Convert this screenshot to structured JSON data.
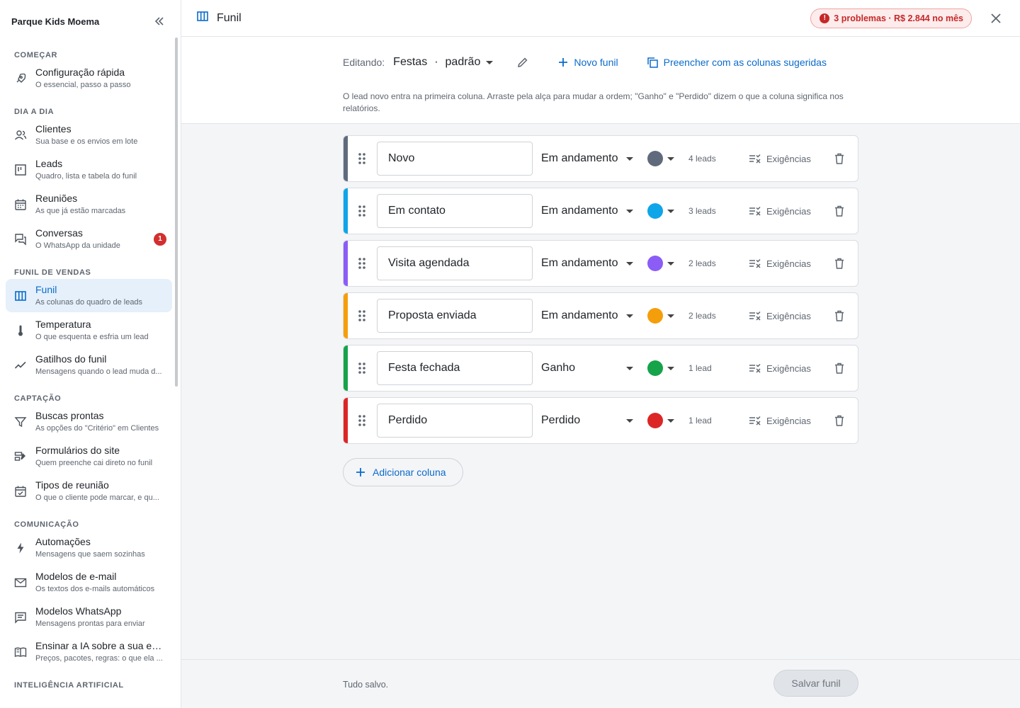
{
  "sidebar": {
    "title": "Parque Kids Moema",
    "sections": [
      {
        "title": "COMEÇAR",
        "items": [
          {
            "name": "configuracao-rapida",
            "icon": "rocket-icon",
            "label": "Configuração rápida",
            "sub": "O essencial, passo a passo"
          }
        ]
      },
      {
        "title": "DIA A DIA",
        "items": [
          {
            "name": "clientes",
            "icon": "people-icon",
            "label": "Clientes",
            "sub": "Sua base e os envios em lote"
          },
          {
            "name": "leads",
            "icon": "board-icon",
            "label": "Leads",
            "sub": "Quadro, lista e tabela do funil"
          },
          {
            "name": "reunioes",
            "icon": "calendar-icon",
            "label": "Reuniões",
            "sub": "As que já estão marcadas"
          },
          {
            "name": "conversas",
            "icon": "chat-icon",
            "label": "Conversas",
            "sub": "O WhatsApp da unidade",
            "badge": "1"
          }
        ]
      },
      {
        "title": "FUNIL DE VENDAS",
        "items": [
          {
            "name": "funil",
            "icon": "columns-icon",
            "label": "Funil",
            "sub": "As colunas do quadro de leads",
            "active": true
          },
          {
            "name": "temperatura",
            "icon": "thermometer-icon",
            "label": "Temperatura",
            "sub": "O que esquenta e esfria um lead"
          },
          {
            "name": "gatilhos",
            "icon": "trend-icon",
            "label": "Gatilhos do funil",
            "sub": "Mensagens quando o lead muda d..."
          }
        ]
      },
      {
        "title": "CAPTAÇÃO",
        "items": [
          {
            "name": "buscas",
            "icon": "filter-icon",
            "label": "Buscas prontas",
            "sub": "As opções do \"Critério\" em Clientes"
          },
          {
            "name": "formularios",
            "icon": "form-icon",
            "label": "Formulários do site",
            "sub": "Quem preenche cai direto no funil"
          },
          {
            "name": "tipos-reuniao",
            "icon": "calendar-check-icon",
            "label": "Tipos de reunião",
            "sub": "O que o cliente pode marcar, e qu..."
          }
        ]
      },
      {
        "title": "COMUNICAÇÃO",
        "items": [
          {
            "name": "automacoes",
            "icon": "bolt-icon",
            "label": "Automações",
            "sub": "Mensagens que saem sozinhas"
          },
          {
            "name": "modelos-email",
            "icon": "mail-icon",
            "label": "Modelos de e-mail",
            "sub": "Os textos dos e-mails automáticos"
          },
          {
            "name": "modelos-whatsapp",
            "icon": "message-icon",
            "label": "Modelos WhatsApp",
            "sub": "Mensagens prontas para enviar"
          },
          {
            "name": "ensinar-ia",
            "icon": "book-icon",
            "label": "Ensinar a IA sobre a sua em...",
            "sub": "Preços, pacotes, regras: o que ela ..."
          }
        ]
      },
      {
        "title": "INTELIGÊNCIA ARTIFICIAL",
        "items": []
      }
    ]
  },
  "topbar": {
    "title": "Funil",
    "problems": "3 problemas · R$ 2.844 no mês"
  },
  "editor": {
    "label": "Editando:",
    "funnel_name": "Festas",
    "funnel_tag": "padrão",
    "new_funnel": "Novo funil",
    "fill_suggested": "Preencher com as colunas sugeridas",
    "hint": "O lead novo entra na primeira coluna. Arraste pela alça para mudar a ordem; \"Ganho\" e \"Perdido\" dizem o que a coluna significa nos relatórios."
  },
  "columns": [
    {
      "name": "Novo",
      "status": "Em andamento",
      "color": "#5f6b7d",
      "count": "4 leads",
      "req": "Exigências"
    },
    {
      "name": "Em contato",
      "status": "Em andamento",
      "color": "#0ea5e9",
      "count": "3 leads",
      "req": "Exigências"
    },
    {
      "name": "Visita agendada",
      "status": "Em andamento",
      "color": "#8b5cf6",
      "count": "2 leads",
      "req": "Exigências"
    },
    {
      "name": "Proposta enviada",
      "status": "Em andamento",
      "color": "#f59e0b",
      "count": "2 leads",
      "req": "Exigências"
    },
    {
      "name": "Festa fechada",
      "status": "Ganho",
      "color": "#16a34a",
      "count": "1 lead",
      "req": "Exigências"
    },
    {
      "name": "Perdido",
      "status": "Perdido",
      "color": "#dc2626",
      "count": "1 lead",
      "req": "Exigências"
    }
  ],
  "add_column": "Adicionar coluna",
  "footer": {
    "status": "Tudo salvo.",
    "save": "Salvar funil"
  }
}
